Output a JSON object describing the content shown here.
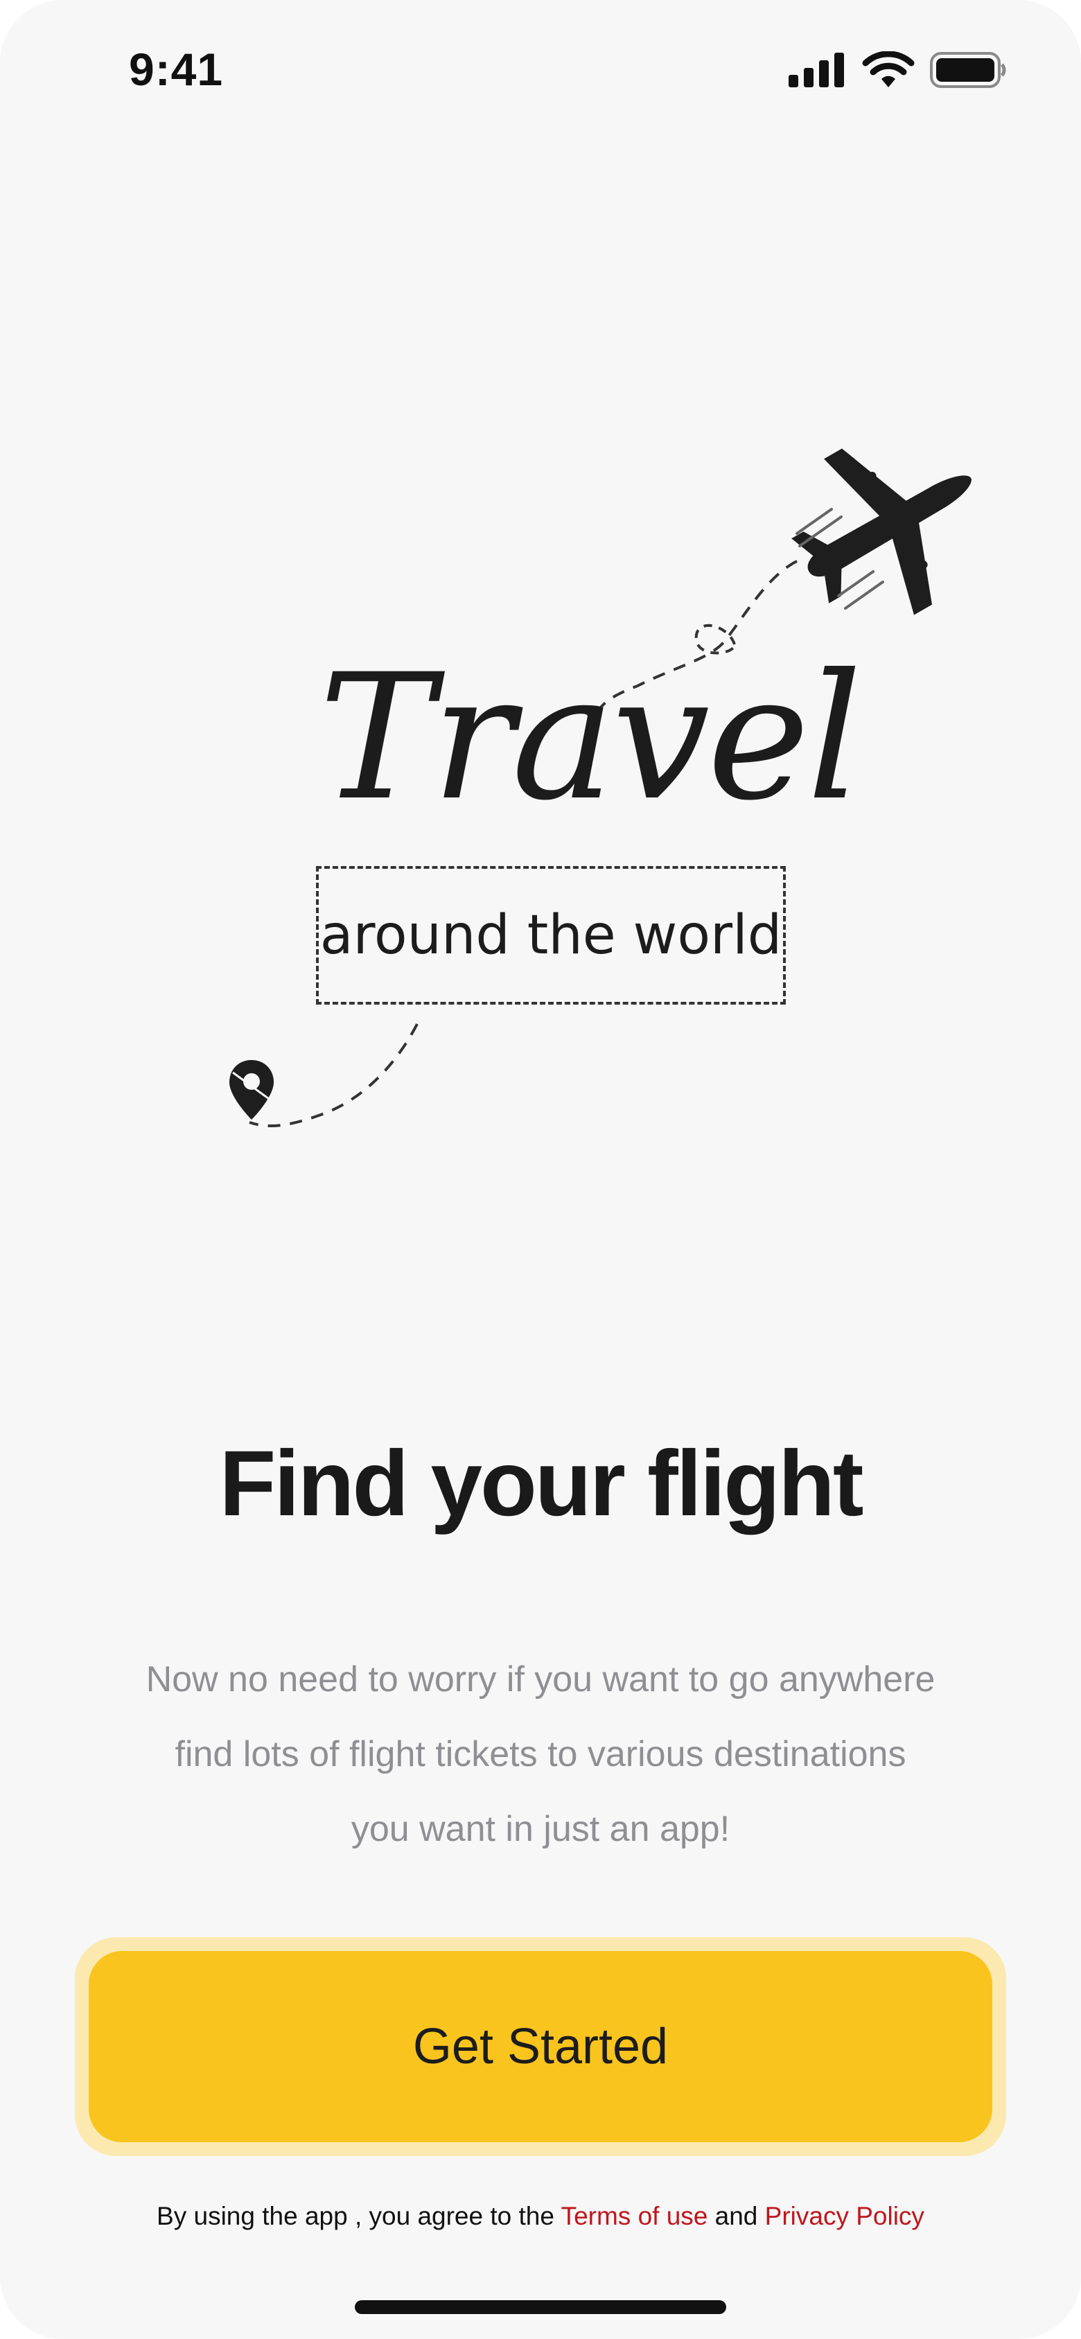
{
  "status_bar": {
    "time": "9:41"
  },
  "illustration": {
    "title": "Travel",
    "tagline": "around the world",
    "icons": [
      "airplane-icon",
      "map-pin-icon"
    ]
  },
  "heading": "Find your flight",
  "description": {
    "line1": "Now no need to worry if you want to go anywhere",
    "line2": "find lots of flight tickets to various destinations",
    "line3": "you want in just an app!"
  },
  "cta": {
    "label": "Get Started"
  },
  "legal": {
    "prefix": "By using the app , you agree to the ",
    "terms_link": "Terms of use",
    "conjunction": " and ",
    "privacy_link": "Privacy Policy"
  },
  "colors": {
    "background": "#f7f7f7",
    "accent": "#f9c41d",
    "accent_halo": "#fbe9b0",
    "link": "#c0161c",
    "muted_text": "#8f8f93",
    "primary_text": "#1a1a1a"
  }
}
